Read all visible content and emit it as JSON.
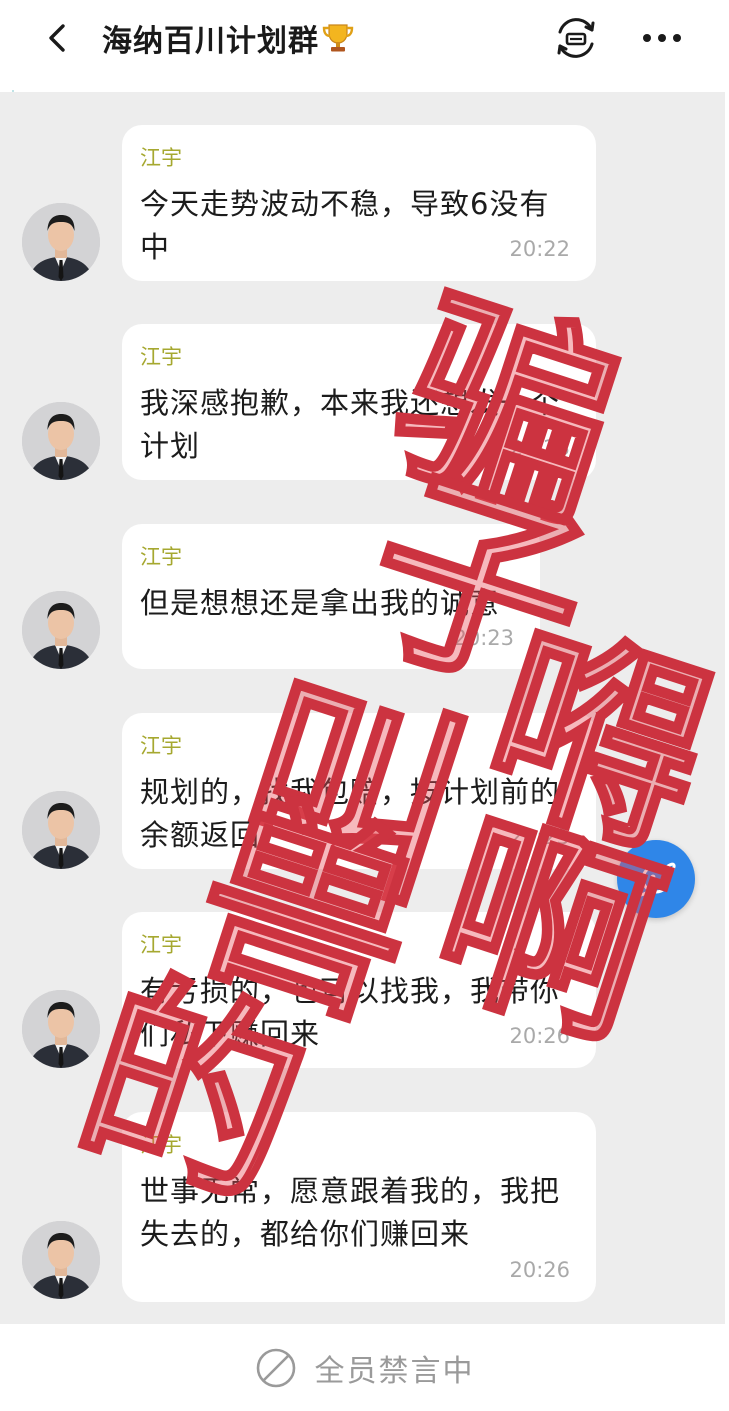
{
  "header": {
    "title": "海纳百川计划群",
    "title_emoji": "🏆"
  },
  "icons": {
    "back": "chevron-left-icon",
    "room": "live-room-icon",
    "more": "more-dots-icon",
    "float": "planet-icon",
    "muted": "prohibited-icon"
  },
  "messages": [
    {
      "sender": "江宇",
      "text": "今天走势波动不稳，导致6没有中",
      "time": "20:22"
    },
    {
      "sender": "江宇",
      "text": "我深感抱歉，本来我还想发一个计划",
      "time": "20:23"
    },
    {
      "sender": "江宇",
      "text": "但是想想还是拿出我的诚意",
      "time": "20:23"
    },
    {
      "sender": "江宇",
      "text": "规划的，找我包赔，按计划前的余额返回",
      "time": "20:25"
    },
    {
      "sender": "江宇",
      "text": "有亏损的，也可以找我，我带你们私下赚回来",
      "time": "20:26"
    },
    {
      "sender": "江宇",
      "text": "世事无常，愿意跟着我的，我把失去的，都给你们赚回来",
      "time": "20:26"
    }
  ],
  "watermark": [
    "骗",
    "子",
    "叫",
    "兽",
    "的",
    "嘚",
    "啊"
  ],
  "bottom": {
    "muted_text": "全员禁言中"
  },
  "colors": {
    "chat_bg": "#ededed",
    "sender_name": "#a6a830",
    "float_button": "#2f86e8",
    "watermark": "#e8505a"
  }
}
